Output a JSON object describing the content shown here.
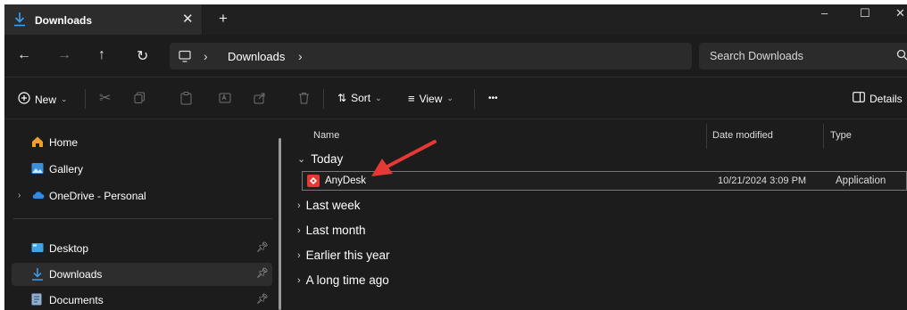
{
  "tab": {
    "title": "Downloads",
    "close": "✕",
    "new_tab": "+"
  },
  "window_controls": {
    "minimize": "–",
    "maximize": "☐",
    "close": "✕"
  },
  "nav": {
    "back": "←",
    "forward": "→",
    "up": "↑",
    "refresh": "↻",
    "breadcrumb_sep": "›",
    "breadcrumb": "Downloads",
    "breadcrumb_more": "›"
  },
  "search": {
    "placeholder": "Search Downloads"
  },
  "toolbar": {
    "new_label": "New",
    "sort_label": "Sort",
    "view_label": "View",
    "more_label": "•••",
    "details_label": "Details"
  },
  "sidebar": {
    "items": [
      {
        "label": "Home"
      },
      {
        "label": "Gallery"
      },
      {
        "label": "OneDrive - Personal"
      },
      {
        "label": "Desktop",
        "pinned": true
      },
      {
        "label": "Downloads",
        "pinned": true,
        "selected": true
      },
      {
        "label": "Documents",
        "pinned": true
      }
    ]
  },
  "columns": {
    "name": "Name",
    "date": "Date modified",
    "type": "Type"
  },
  "groups": [
    {
      "label": "Today",
      "expanded": true
    },
    {
      "label": "Last week",
      "expanded": false
    },
    {
      "label": "Last month",
      "expanded": false
    },
    {
      "label": "Earlier this year",
      "expanded": false
    },
    {
      "label": "A long time ago",
      "expanded": false
    }
  ],
  "files": [
    {
      "name": "AnyDesk",
      "date": "10/21/2024 3:09 PM",
      "type": "Application"
    }
  ],
  "colors": {
    "background": "#1c1c1c",
    "accent_arrow": "#e53935",
    "download_icon": "#3aa0f0"
  }
}
